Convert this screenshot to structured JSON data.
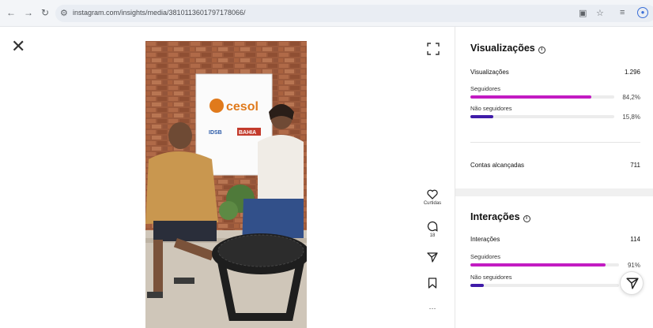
{
  "browser": {
    "back_icon": "←",
    "forward_icon": "→",
    "reload_icon": "↻",
    "url": "instagram.com/insights/media/3810113601797178066/"
  },
  "post": {
    "media_alt": "photo-of-two-people-seated-in-front-of-cesol-banner",
    "banner_brand": "cesol",
    "banner_partners": [
      "IDSB",
      "BAHIA"
    ],
    "likes_label": "Curtidas",
    "comments_count": "18",
    "more_label": "···"
  },
  "views": {
    "title": "Visualizações",
    "row_label": "Visualizações",
    "row_value": "1.296",
    "followers_label": "Seguidores",
    "followers_pct": "84,2%",
    "followers_fraction": 0.842,
    "non_followers_label": "Não seguidores",
    "non_followers_pct": "15,8%",
    "non_followers_fraction": 0.158,
    "reached_label": "Contas alcançadas",
    "reached_value": "711"
  },
  "interactions": {
    "title": "Interações",
    "row_label": "Interações",
    "row_value": "114",
    "followers_label": "Seguidores",
    "followers_pct": "91%",
    "followers_fraction": 0.91,
    "non_followers_label": "Não seguidores",
    "non_followers_pct": "9%",
    "non_followers_fraction": 0.09
  },
  "colors": {
    "followers_bar": "#c21bc2",
    "non_followers_bar": "#3f1ba8",
    "track": "#ececec"
  }
}
